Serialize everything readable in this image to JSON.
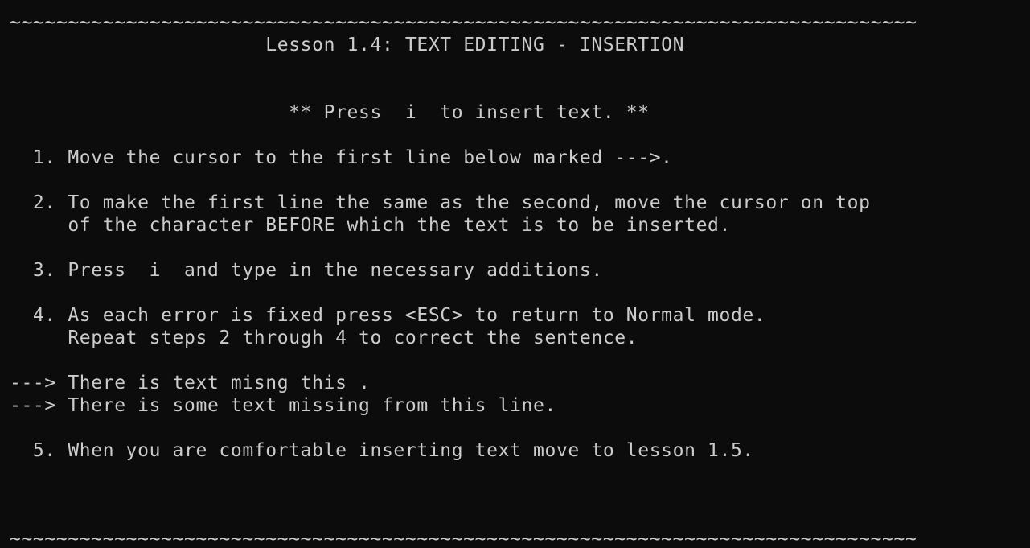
{
  "terminal": {
    "background": "#0c0c0c",
    "foreground": "#cccccc",
    "lines": [
      "~~~~~~~~~~~~~~~~~~~~~~~~~~~~~~~~~~~~~~~~~~~~~~~~~~~~~~~~~~~~~~~~~~~~~~~~~~~~~~",
      "                      Lesson 1.4: TEXT EDITING - INSERTION",
      "",
      "",
      "                        ** Press  i  to insert text. **",
      "",
      "  1. Move the cursor to the first line below marked --->.",
      "",
      "  2. To make the first line the same as the second, move the cursor on top",
      "     of the character BEFORE which the text is to be inserted.",
      "",
      "  3. Press  i  and type in the necessary additions.",
      "",
      "  4. As each error is fixed press <ESC> to return to Normal mode.",
      "     Repeat steps 2 through 4 to correct the sentence.",
      "",
      "---> There is text misng this .",
      "---> There is some text missing from this line.",
      "",
      "  5. When you are comfortable inserting text move to lesson 1.5.",
      "",
      "",
      "",
      "~~~~~~~~~~~~~~~~~~~~~~~~~~~~~~~~~~~~~~~~~~~~~~~~~~~~~~~~~~~~~~~~~~~~~~~~~~~~~~"
    ]
  }
}
